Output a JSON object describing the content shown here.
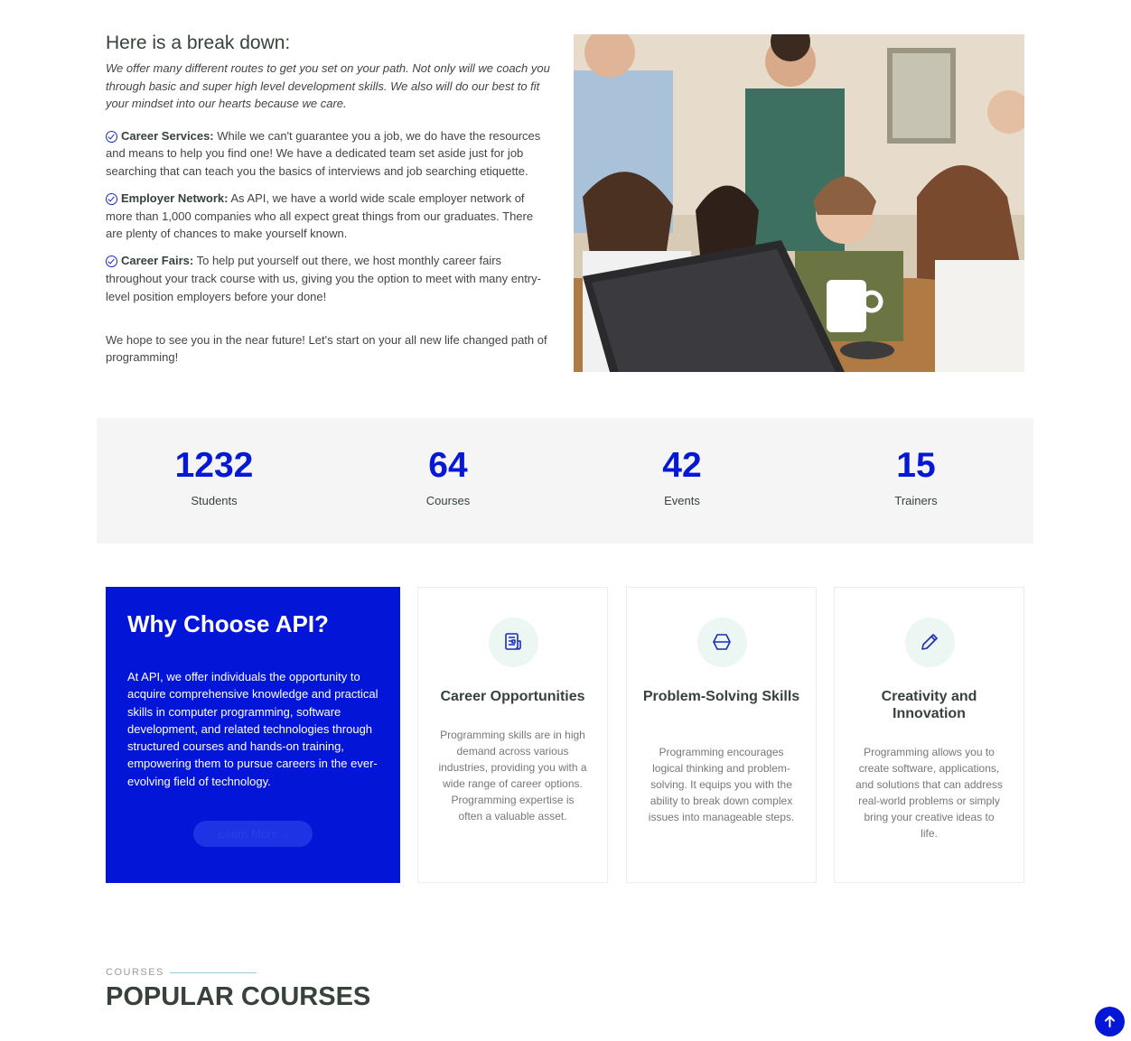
{
  "breakdown": {
    "title": "Here is a break down:",
    "intro": "We offer many different routes to get you set on your path. Not only will we coach you through basic and super high level development skills. We also will do our best to fit your mindset into our hearts because we care.",
    "items": [
      {
        "title": "Career Services:",
        "text": " While we can't guarantee you a job, we do have the resources and means to help you find one! We have a dedicated team set aside just for job searching that can teach you the basics of interviews and job searching etiquette.",
        "icon": "check-circle-icon"
      },
      {
        "title": "Employer Network:",
        "text": " As API, we have a world wide scale employer network of more than 1,000 companies who all expect great things from our graduates. There are plenty of chances to make yourself known.",
        "icon": "check-circle-icon"
      },
      {
        "title": "Career Fairs:",
        "text": " To help put yourself out there, we host monthly career fairs throughout your track course with us, giving you the option to meet with many entry-level position employers before your done!",
        "icon": "check-circle-icon"
      }
    ],
    "outro": "We hope to see you in the near future! Let's start on your all new life changed path of programming!"
  },
  "counters": [
    {
      "value": "1232",
      "label": "Students"
    },
    {
      "value": "64",
      "label": "Courses"
    },
    {
      "value": "42",
      "label": "Events"
    },
    {
      "value": "15",
      "label": "Trainers"
    }
  ],
  "why": {
    "title": "Why Choose API?",
    "text": "At API, we offer individuals the opportunity to acquire comprehensive knowledge and practical skills in computer programming, software development, and related technologies through structured courses and hands-on training, empowering them to pursue careers in the ever-evolving field of technology.",
    "button": "Learn More",
    "button_icon": "chevron-right-icon"
  },
  "cards": [
    {
      "title": "Career Opportunities",
      "icon": "receipt-icon",
      "text": "Programming skills are in high demand across various industries, providing you with a wide range of career options. Programming expertise is often a valuable asset."
    },
    {
      "title": "Problem-Solving Skills",
      "icon": "cube-icon",
      "text": "Programming encourages logical thinking and problem-solving. It equips you with the ability to break down complex issues into manageable steps."
    },
    {
      "title": "Creativity and Innovation",
      "icon": "pencil-icon",
      "text": "Programming allows you to create software, applications, and solutions that can address real-world problems or simply bring your creative ideas to life."
    }
  ],
  "courses": {
    "label": "COURSES",
    "title": "POPULAR COURSES"
  },
  "colors": {
    "accent": "#0316d8",
    "icon_bg": "#ecf6f2",
    "counter_bg": "#f5f5f5"
  },
  "back_to_top_icon": "arrow-up-icon"
}
